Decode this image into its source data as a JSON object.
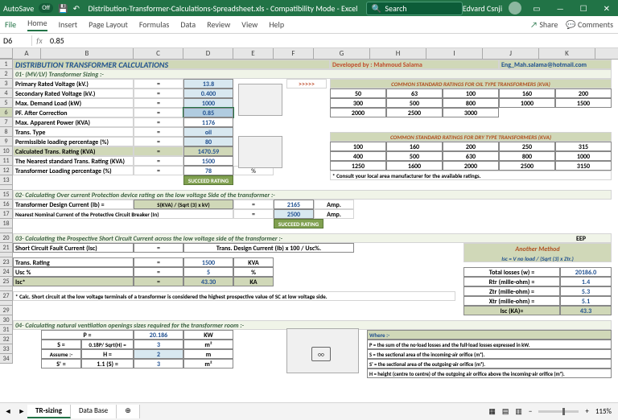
{
  "titlebar": {
    "autosave": "AutoSave",
    "off": "Off",
    "filename": "Distribution-Transformer-Calculations-Spreadsheet.xls  -  Compatibility Mode  -  Excel",
    "search": "Search",
    "user": "Edvard Csnji"
  },
  "tabs": {
    "file": "File",
    "home": "Home",
    "insert": "Insert",
    "pagelayout": "Page Layout",
    "formulas": "Formulas",
    "data": "Data",
    "review": "Review",
    "view": "View",
    "help": "Help",
    "share": "Share",
    "comments": "Comments"
  },
  "formula": {
    "cell": "D6",
    "value": "0.85"
  },
  "cols": [
    "A",
    "B",
    "C",
    "D",
    "E",
    "F",
    "G",
    "H",
    "I",
    "J",
    "K"
  ],
  "title": "DISTRIBUTION TRANSFORMER CALCULATIONS",
  "developed": "Developed by : Mahmoud Salama",
  "email": "Eng_Mah.salama@hotmail.com",
  "s1": "01- (MV/LV) Transformer Sizing :-",
  "r3l": "Primary Rated Voltage (kV.)",
  "r3v": "13.8",
  "r4l": "Secondary Rated Voltage (kV.)",
  "r4v": "0.400",
  "r5l": "Max. Demand Load (kW)",
  "r5v": "1000",
  "r6l": "PF. After Correction",
  "r6v": "0.85",
  "r7l": "Max. Apparent Power (KVA)",
  "r7v": "1176",
  "r8l": "Trans. Type",
  "r8v": "oil",
  "r9l": "Permissible loading percentage (%)",
  "r9v": "80",
  "r10l": "Calculated Trans. Rating (KVA)",
  "r10v": "1470.59",
  "r11l": "The Nearest standard Trans. Rating (KVA)",
  "r11v": "1500",
  "r12l": "Transformer Loading percentage (%)",
  "r12v": "78",
  "r12p": "%",
  "succeed": "SUCCEED RATING",
  "arrow": ">>>>>",
  "oilhead": "COMMON STANDARD RATINGS FOR OIL TYPE TRANSFORMERS (KVA)",
  "oil": [
    [
      "50",
      "63",
      "100",
      "160",
      "200"
    ],
    [
      "300",
      "500",
      "800",
      "1000",
      "1500"
    ],
    [
      "2000",
      "2500",
      "3000",
      "",
      ""
    ]
  ],
  "dryhead": "COMMON STANDARD RATINGS FOR DRY TYPE TRANSFORMERS  (KVA)",
  "dry": [
    [
      "100",
      "160",
      "200",
      "250",
      "315"
    ],
    [
      "400",
      "500",
      "630",
      "800",
      "1000"
    ],
    [
      "1250",
      "1600",
      "2000",
      "2500",
      "3150"
    ]
  ],
  "consult": "* Consult your local area manufacturer for the available ratings.",
  "s2": "02- Calculating Over current Protection device rating on the low voltage Side of the transformer :-",
  "r16l": "Transformer Design Current (Ib)        =",
  "r16f": "S(KVA) / (Sqrt (3) x kV)",
  "r16v": "2165",
  "amp": "Amp.",
  "r17l": "Nearest Nominal Current of the Protective Circuit Breaker (In)",
  "r17v": "2500",
  "s3": "03- Calculating the Prospective Short Circuit Current  across the low voltage side of the transformer :-",
  "r21l": "Short Circuit Fault Current (Isc)",
  "r21f": "Trans. Design Current (Ib) x 100 / Usc%.",
  "r23l": "Trans. Rating",
  "r23v": "1500",
  "kva": "KVA",
  "r24l": "Usc %",
  "r24v": "5",
  "pct": "%",
  "r25l": "Isc*",
  "r25v": "43.30",
  "ka": "KA",
  "note": "* Calc. Short circuit at the low voltage terminals of a transformer is considered the highest prospective value of SC at low voltage side.",
  "another": "Another Method",
  "iscf": "Isc = V no load / (Sqrt (3) x Ztr.)",
  "tl": "Total losses (w) =",
  "tlv": "20186.0",
  "rtr": "Rtr (mille-ohm) =",
  "rtrv": "1.4",
  "ztr": "Ztr (mille-ohm) =",
  "ztrv": "5.3",
  "xtr": "Xtr (mille-ohm) =",
  "xtrv": "5.1",
  "iscka": "Isc (KA)=",
  "isckav": "43.3",
  "s4": "04- Calculating natural ventilation openings sizes required for the transformer room :-",
  "r30l": "P =",
  "r30v": "20.186",
  "kw": "KW",
  "r31l": "S =",
  "r31f": "0.18P/ Sqrt(H) =",
  "r31v": "3",
  "m2": "m²",
  "r32l": "Assume :-",
  "r32f": "H =",
  "r32v": "2",
  "m": "m",
  "r33l": "S' =",
  "r33f": "1.1 (S) =",
  "r33v": "3",
  "where": "Where :-",
  "wp": "P = the sum of the no-load losses and the full-load losses expressed in kW.",
  "ws": "S = the sectional area of the incoming-air orifice (m²).",
  "ws2": "S' = the sectional area of the outgoing-air orifice (m²).",
  "wh": "H = height (centre to centre) of the outgoing air orifice above the incoming-air orifice (m²).",
  "sheets": {
    "tr": "TR-sizing",
    "db": "Data Base"
  },
  "zoom": "115%"
}
